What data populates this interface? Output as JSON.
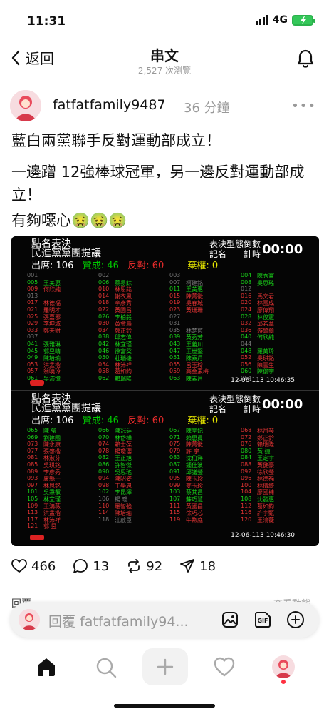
{
  "status": {
    "time": "11:31",
    "network": "4G"
  },
  "header": {
    "back_label": "返回",
    "title": "串文",
    "views": "2,527 次瀏覽"
  },
  "post": {
    "username": "fatfatfamily9487",
    "time_ago": "36 分鐘",
    "more": "•••",
    "lines": [
      "藍白兩黨聯手反對運動部成立！",
      "一邊蹭 12強棒球冠軍，另一邊反對運動部成",
      "立！",
      "有夠噁心🤢🤢🤢"
    ]
  },
  "vote_boards": [
    {
      "title1": "點名表決",
      "title2": "民進黨黨團提議",
      "present_label": "出席:",
      "present": "106",
      "yes_label": "贊成:",
      "yes": "46",
      "no_label": "反對:",
      "no": "60",
      "abstain_label": "棄權:",
      "abstain": "0",
      "type_label": "表決型態\n記名",
      "timer_label": "倒數\n計時",
      "timer": "00:00",
      "timestamp": "12-06-113 10:46:35",
      "rows": [
        [
          [
            "001",
            "",
            "gr"
          ],
          [
            "002",
            "",
            "gr"
          ],
          [
            "003",
            "",
            "gr"
          ],
          [
            "004",
            "陳秀寶",
            "g"
          ]
        ],
        [
          [
            "005",
            "王美惠",
            "g"
          ],
          [
            "006",
            "蔡易餘",
            "g"
          ],
          [
            "007",
            "柯建銘",
            "gr"
          ],
          [
            "008",
            "吳思瑤",
            "g"
          ]
        ],
        [
          [
            "009",
            "何欣純",
            "r"
          ],
          [
            "010",
            "林思銘",
            "r"
          ],
          [
            "011",
            "王美惠",
            "g"
          ],
          [
            "012",
            "",
            "gr"
          ]
        ],
        [
          [
            "013",
            "",
            "gr"
          ],
          [
            "014",
            "謝衣鳳",
            "r"
          ],
          [
            "015",
            "陳菁徽",
            "r"
          ],
          [
            "016",
            "馬文君",
            "r"
          ]
        ],
        [
          [
            "017",
            "林德福",
            "r"
          ],
          [
            "018",
            "李彥秀",
            "r"
          ],
          [
            "019",
            "吳春城",
            "r"
          ],
          [
            "020",
            "林國成",
            "r"
          ]
        ],
        [
          [
            "021",
            "羅明才",
            "r"
          ],
          [
            "022",
            "黃國昌",
            "r"
          ],
          [
            "023",
            "黃珊珊",
            "r"
          ],
          [
            "024",
            "廖偉翔",
            "r"
          ]
        ],
        [
          [
            "025",
            "張嘉郡",
            "r"
          ],
          [
            "026",
            "李柏毅",
            "g"
          ],
          [
            "027",
            "",
            "gr"
          ],
          [
            "028",
            "林俊憲",
            "g"
          ]
        ],
        [
          [
            "029",
            "李坤城",
            "r"
          ],
          [
            "030",
            "黃金島",
            "r"
          ],
          [
            "031",
            "",
            "gr"
          ],
          [
            "032",
            "邱若華",
            "r"
          ]
        ],
        [
          [
            "033",
            "鄭天財",
            "r"
          ],
          [
            "034",
            "鄭正鈐",
            "r"
          ],
          [
            "035",
            "林楚茵",
            "gr"
          ],
          [
            "036",
            "游毓蘭",
            "r"
          ]
        ],
        [
          [
            "037",
            "",
            "gr"
          ],
          [
            "038",
            "邱志偉",
            "g"
          ],
          [
            "039",
            "黃秀芳",
            "g"
          ],
          [
            "040",
            "何欣純",
            "g"
          ]
        ],
        [
          [
            "041",
            "張雅琳",
            "g"
          ],
          [
            "042",
            "林宜瑾",
            "g"
          ],
          [
            "043",
            "王義川",
            "g"
          ],
          [
            "044",
            "",
            "gr"
          ]
        ],
        [
          [
            "045",
            "郭昱晴",
            "g"
          ],
          [
            "046",
            "徐富癸",
            "g"
          ],
          [
            "047",
            "王世堅",
            "g"
          ],
          [
            "048",
            "羅美玲",
            "g"
          ]
        ],
        [
          [
            "049",
            "陳培瑜",
            "g"
          ],
          [
            "050",
            "莊瑞雄",
            "g"
          ],
          [
            "051",
            "陳素月",
            "g"
          ],
          [
            "052",
            "吳琪銘",
            "r"
          ]
        ],
        [
          [
            "053",
            "洪孟楷",
            "r"
          ],
          [
            "054",
            "林沛祥",
            "r"
          ],
          [
            "055",
            "呂玉玲",
            "r"
          ],
          [
            "056",
            "陳雪生",
            "r"
          ]
        ],
        [
          [
            "057",
            "翁曉玲",
            "r"
          ],
          [
            "058",
            "葛如鈞",
            "r"
          ],
          [
            "059",
            "高金素梅",
            "r"
          ],
          [
            "060",
            "陳俊宇",
            "g"
          ]
        ],
        [
          [
            "061",
            "吳沛憶",
            "g"
          ],
          [
            "062",
            "賴瑞隆",
            "g"
          ],
          [
            "063",
            "陳素月",
            "g"
          ],
          [
            "064",
            "",
            "gr"
          ]
        ]
      ]
    },
    {
      "title1": "點名表決",
      "title2": "民進黨黨團提議",
      "present_label": "出席:",
      "present": "106",
      "yes_label": "贊成:",
      "yes": "46",
      "no_label": "反對:",
      "no": "60",
      "abstain_label": "棄權:",
      "abstain": "0",
      "type_label": "表決型態\n記名",
      "timer_label": "倒數\n計時",
      "timer": "00:00",
      "timestamp": "12-06-113 10:46:30",
      "rows": [
        [
          [
            "065",
            "陳 瑩",
            "g"
          ],
          [
            "066",
            "陳冠廷",
            "g"
          ],
          [
            "067",
            "陳亭妃",
            "g"
          ],
          [
            "068",
            "林月琴",
            "r"
          ]
        ],
        [
          [
            "069",
            "劉建國",
            "g"
          ],
          [
            "070",
            "林岱樺",
            "g"
          ],
          [
            "071",
            "賴惠員",
            "g"
          ],
          [
            "072",
            "鄭正鈐",
            "r"
          ]
        ],
        [
          [
            "073",
            "陳永康",
            "r"
          ],
          [
            "074",
            "賴士葆",
            "r"
          ],
          [
            "075",
            "陳菁徽",
            "r"
          ],
          [
            "076",
            "賴瑞隆",
            "r"
          ]
        ],
        [
          [
            "077",
            "張啓楷",
            "r"
          ],
          [
            "078",
            "楊瓊瓔",
            "r"
          ],
          [
            "079",
            "許 宇",
            "r"
          ],
          [
            "080",
            "黃 捷",
            "g"
          ]
        ],
        [
          [
            "081",
            "林淑芬",
            "r"
          ],
          [
            "082",
            "王正旭",
            "g"
          ],
          [
            "083",
            "沈伯洋",
            "g"
          ],
          [
            "084",
            "王定宇",
            "g"
          ]
        ],
        [
          [
            "085",
            "吳琪銘",
            "r"
          ],
          [
            "086",
            "許智傑",
            "g"
          ],
          [
            "087",
            "鍾佳濱",
            "g"
          ],
          [
            "088",
            "黃健豪",
            "r"
          ]
        ],
        [
          [
            "089",
            "李彥秀",
            "r"
          ],
          [
            "090",
            "吳思瑤",
            "g"
          ],
          [
            "091",
            "邱議瑩",
            "g"
          ],
          [
            "092",
            "徐欣瑩",
            "r"
          ]
        ],
        [
          [
            "093",
            "盧縣一",
            "r"
          ],
          [
            "094",
            "陳昭姿",
            "r"
          ],
          [
            "095",
            "陳玉珍",
            "r"
          ],
          [
            "096",
            "林德福",
            "r"
          ]
        ],
        [
          [
            "097",
            "林思銘",
            "r"
          ],
          [
            "098",
            "丁學忠",
            "r"
          ],
          [
            "099",
            "麥玉珍",
            "r"
          ],
          [
            "100",
            "林倩綺",
            "r"
          ]
        ],
        [
          [
            "101",
            "吳秉叡",
            "g"
          ],
          [
            "102",
            "李昆澤",
            "g"
          ],
          [
            "103",
            "蔡其昌",
            "g"
          ],
          [
            "104",
            "廖國棟",
            "r"
          ]
        ],
        [
          [
            "105",
            "林宜瑾",
            "g"
          ],
          [
            "106",
            "楊 瓊",
            "gr"
          ],
          [
            "107",
            "蘇巧慧",
            "g"
          ],
          [
            "108",
            "沈發惠",
            "g"
          ]
        ],
        [
          [
            "109",
            "王鴻薇",
            "r"
          ],
          [
            "110",
            "羅智強",
            "r"
          ],
          [
            "111",
            "黃國昌",
            "r"
          ],
          [
            "112",
            "葛如鈞",
            "r"
          ]
        ],
        [
          [
            "113",
            "洪孟楷",
            "r"
          ],
          [
            "114",
            "陳培瑜",
            "r"
          ],
          [
            "115",
            "徐巧芯",
            "r"
          ],
          [
            "116",
            "許宇甄",
            "r"
          ]
        ],
        [
          [
            "117",
            "林沛祥",
            "r"
          ],
          [
            "118",
            "江啟臣",
            "gr"
          ],
          [
            "119",
            "牛煦庭",
            "r"
          ],
          [
            "120",
            "王鴻薇",
            "r"
          ]
        ],
        [
          [
            "121",
            "郭 昱",
            "r"
          ],
          [
            "",
            "",
            ""
          ],
          [
            "",
            "",
            ""
          ],
          [
            "",
            "",
            ""
          ]
        ]
      ]
    }
  ],
  "actions": {
    "likes": "466",
    "comments": "13",
    "reposts": "92",
    "shares": "18"
  },
  "peek": {
    "left": "回覆",
    "right": "查看動態"
  },
  "reply": {
    "placeholder": "回覆 fatfatfamily94..."
  },
  "colors": {
    "yes": "#19d219",
    "no": "#e33434",
    "abstain": "#e5e500",
    "absent": "#777777",
    "battery": "#34c759",
    "badge": "#ff3040"
  },
  "icons": [
    "chevron-left-icon",
    "bell-icon",
    "heart-icon",
    "comment-icon",
    "repost-icon",
    "send-icon",
    "image-icon",
    "gif-icon",
    "plus-icon",
    "home-icon",
    "search-icon",
    "add-icon",
    "heart-tab-icon"
  ]
}
